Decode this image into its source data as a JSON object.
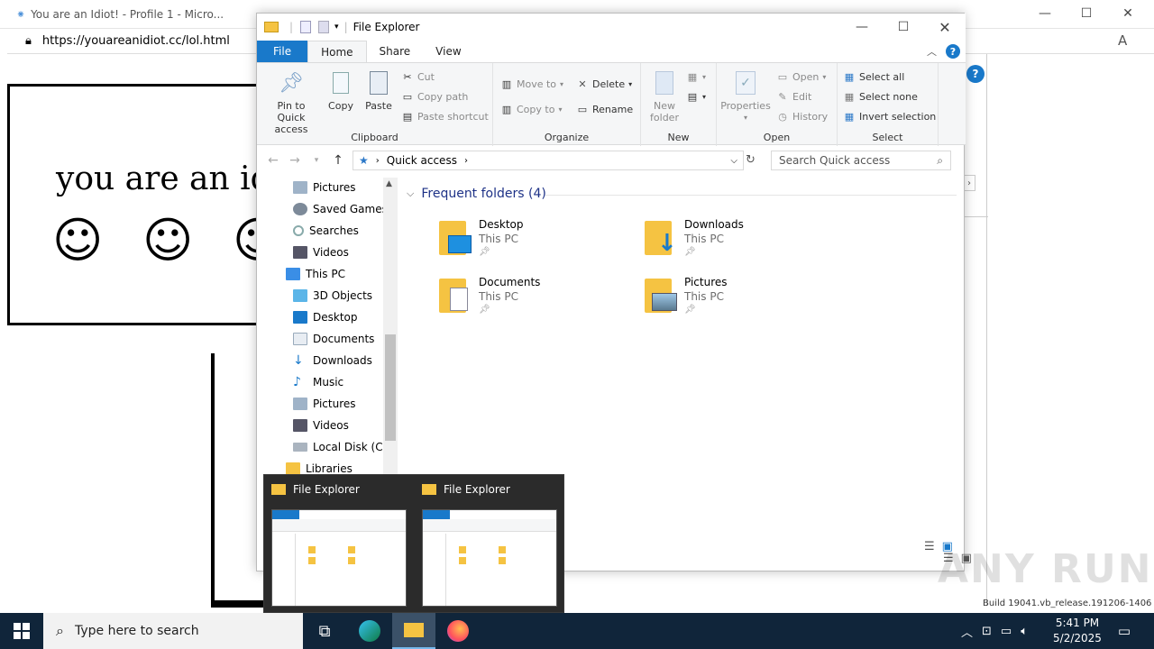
{
  "browser": {
    "tab_title": "You are an Idiot! - Profile 1 - Micro...",
    "url_prefix": "https://",
    "url_domain": "youareanidiot.cc",
    "url_path": "/lol.html",
    "second_tab_title": "You are an Idiot! - Profile 1 - Micro...",
    "page_text": "you are an idi",
    "smiley": "☺",
    "reader_icon": "A"
  },
  "explorer": {
    "title": "File Explorer",
    "tabs": {
      "file": "File",
      "home": "Home",
      "share": "Share",
      "view": "View"
    },
    "clipboard": {
      "pin": "Pin to Quick access",
      "copy": "Copy",
      "paste": "Paste",
      "cut": "Cut",
      "copy_path": "Copy path",
      "paste_shortcut": "Paste shortcut",
      "label": "Clipboard"
    },
    "organize": {
      "move_to": "Move to",
      "copy_to": "Copy to",
      "delete": "Delete",
      "rename": "Rename",
      "label": "Organize"
    },
    "new": {
      "new_folder": "New folder",
      "label": "New"
    },
    "open": {
      "properties": "Properties",
      "open": "Open",
      "edit": "Edit",
      "history": "History",
      "label": "Open"
    },
    "select": {
      "select_all": "Select all",
      "select_none": "Select none",
      "invert": "Invert selection",
      "label": "Select"
    },
    "address": {
      "path": "Quick access",
      "search_placeholder": "Search Quick access"
    },
    "nav": [
      "Pictures",
      "Saved Games",
      "Searches",
      "Videos",
      "This PC",
      "3D Objects",
      "Desktop",
      "Documents",
      "Downloads",
      "Music",
      "Pictures",
      "Videos",
      "Local Disk (C:)",
      "Libraries"
    ],
    "section": "Frequent folders (4)",
    "folders": [
      {
        "name": "Desktop",
        "loc": "This PC"
      },
      {
        "name": "Downloads",
        "loc": "This PC"
      },
      {
        "name": "Documents",
        "loc": "This PC"
      },
      {
        "name": "Pictures",
        "loc": "This PC"
      }
    ]
  },
  "previews": [
    {
      "title": "File Explorer"
    },
    {
      "title": "File Explorer"
    }
  ],
  "taskbar": {
    "search_placeholder": "Type here to search",
    "time": "5:41 PM",
    "date": "5/2/2025"
  },
  "watermark": "ANY RUN",
  "build_text": "Build 19041.vb_release.191206-1406"
}
